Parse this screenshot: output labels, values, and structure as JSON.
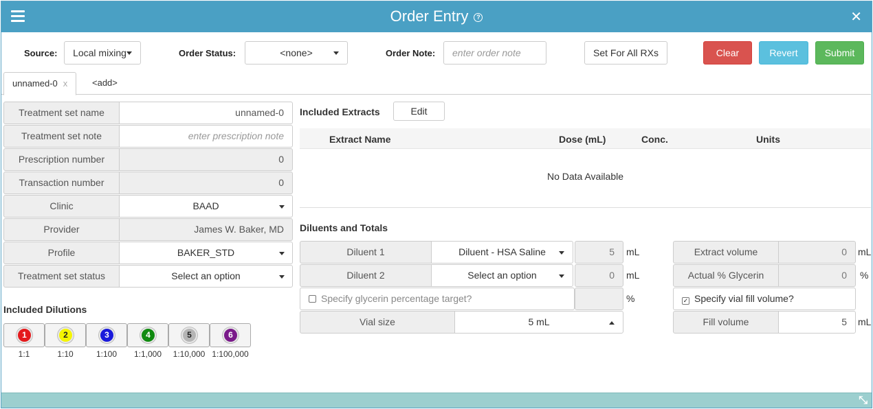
{
  "titlebar": {
    "title": "Order Entry",
    "help_icon": "?",
    "close_icon": "✕"
  },
  "toolbar": {
    "source_label": "Source:",
    "source_value": "Local mixing",
    "status_label": "Order Status:",
    "status_value": "<none>",
    "note_label": "Order Note:",
    "note_placeholder": "enter order note",
    "set_all_label": "Set For All RXs",
    "clear_label": "Clear",
    "revert_label": "Revert",
    "submit_label": "Submit",
    "colors": {
      "clear": "#d9534f",
      "revert": "#5bc0de",
      "submit": "#5cb85c"
    }
  },
  "tabs": [
    {
      "label": "unnamed-0",
      "close": "x",
      "active": true
    },
    {
      "label": "<add>"
    }
  ],
  "form": {
    "treatment_set_name": {
      "label": "Treatment set name",
      "value": "unnamed-0"
    },
    "treatment_set_note": {
      "label": "Treatment set note",
      "placeholder": "enter prescription note"
    },
    "prescription_number": {
      "label": "Prescription number",
      "value": "0"
    },
    "transaction_number": {
      "label": "Transaction number",
      "value": "0"
    },
    "clinic": {
      "label": "Clinic",
      "value": "BAAD"
    },
    "provider": {
      "label": "Provider",
      "value": "James W. Baker, MD"
    },
    "profile": {
      "label": "Profile",
      "value": "BAKER_STD"
    },
    "status": {
      "label": "Treatment set status",
      "value": "Select an option"
    }
  },
  "dilutions": {
    "heading": "Included Dilutions",
    "items": [
      {
        "num": "1",
        "ratio": "1:1",
        "color": "#e41a1c",
        "text_color": "#ffffff"
      },
      {
        "num": "2",
        "ratio": "1:10",
        "color": "#f5f500",
        "text_color": "#222222"
      },
      {
        "num": "3",
        "ratio": "1:100",
        "color": "#1a1adb",
        "text_color": "#ffffff"
      },
      {
        "num": "4",
        "ratio": "1:1,000",
        "color": "#108a10",
        "text_color": "#ffffff"
      },
      {
        "num": "5",
        "ratio": "1:10,000",
        "color": "#b5b5b5",
        "text_color": "#222222"
      },
      {
        "num": "6",
        "ratio": "1:100,000",
        "color": "#7a1a8a",
        "text_color": "#ffffff"
      }
    ]
  },
  "extracts": {
    "heading": "Included Extracts",
    "edit_label": "Edit",
    "columns": [
      "Extract Name",
      "Dose (mL)",
      "Conc.",
      "Units"
    ],
    "empty_text": "No Data Available"
  },
  "diluents": {
    "heading": "Diluents and Totals",
    "d1_label": "Diluent 1",
    "d1_value": "Diluent - HSA Saline",
    "d1_amount": "5",
    "d1_unit": "mL",
    "d2_label": "Diluent 2",
    "d2_value": "Select an option",
    "d2_amount": "0",
    "d2_unit": "mL",
    "glycerin_target_label": "Specify glycerin percentage target?",
    "glycerin_unit": "%",
    "vial_size_label": "Vial size",
    "vial_size_value": "5 mL",
    "extract_volume_label": "Extract volume",
    "extract_volume_value": "0",
    "extract_volume_unit": "mL",
    "actual_glycerin_label": "Actual % Glycerin",
    "actual_glycerin_value": "0",
    "actual_glycerin_unit": "%",
    "vial_fill_label": "Specify vial fill volume?",
    "vial_fill_checked": true,
    "fill_volume_label": "Fill volume",
    "fill_volume_value": "5",
    "fill_volume_unit": "mL"
  }
}
